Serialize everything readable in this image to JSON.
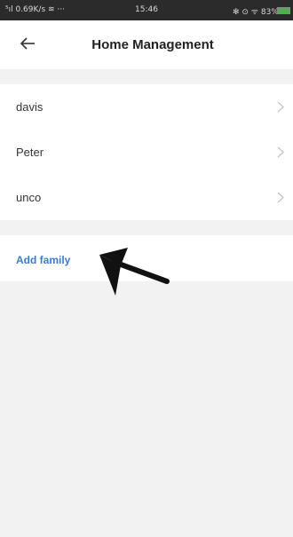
{
  "status_bar": {
    "left": "⁵ıl 0.69K/s ≋ ···",
    "time": "15:46",
    "right": "✻ ⊙ ᯤ 83%"
  },
  "header": {
    "title": "Home Management",
    "back_icon": "arrow-left-icon"
  },
  "members": [
    {
      "label": "davis"
    },
    {
      "label": "Peter"
    },
    {
      "label": "unco"
    }
  ],
  "add_family": {
    "label": "Add family"
  },
  "colors": {
    "accent": "#3a7bd5",
    "background": "#f2f2f2",
    "status_bar": "#2b2b2b"
  }
}
